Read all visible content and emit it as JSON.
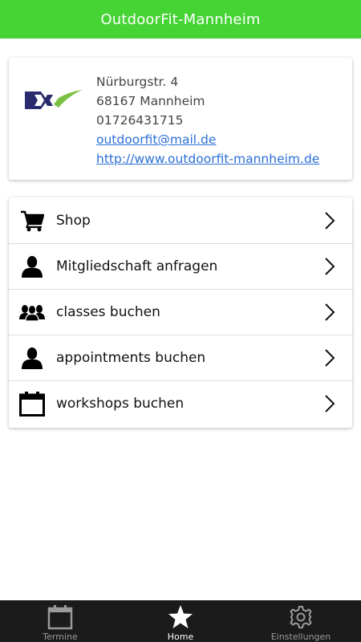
{
  "app": {
    "title": "OutdoorFit-Mannheim",
    "accent": "#46d334"
  },
  "contact": {
    "street": "Nürburgstr. 4",
    "city": "68167 Mannheim",
    "phone": "01726431715",
    "email": "outdoorfit@mail.de",
    "website": "http://www.outdoorfit-mannheim.de"
  },
  "menu": [
    {
      "label": "Shop",
      "icon": "cart-icon"
    },
    {
      "label": "Mitgliedschaft anfragen",
      "icon": "person-icon"
    },
    {
      "label": "classes buchen",
      "icon": "group-icon"
    },
    {
      "label": "appointments buchen",
      "icon": "person-icon"
    },
    {
      "label": "workshops buchen",
      "icon": "calendar-icon"
    }
  ],
  "tabs": [
    {
      "label": "Termine",
      "icon": "calendar-icon",
      "active": false
    },
    {
      "label": "Home",
      "icon": "star-icon",
      "active": true
    },
    {
      "label": "Einstellungen",
      "icon": "gear-icon",
      "active": false
    }
  ]
}
